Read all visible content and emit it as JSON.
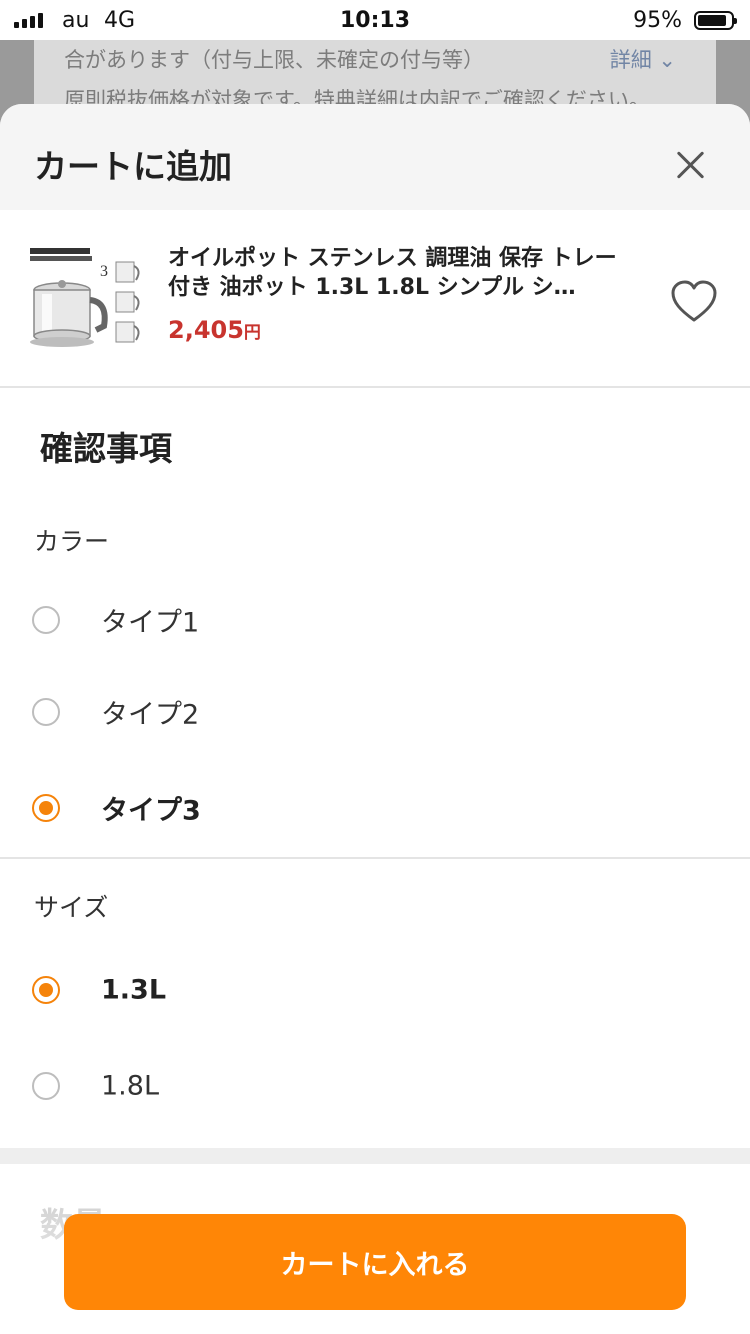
{
  "status": {
    "carrier": "au",
    "network": "4G",
    "time": "10:13",
    "battery": "95%"
  },
  "background_page": {
    "line1": "合があります（付与上限、未確定の付与等）",
    "line2": "原則税抜価格が対象です。特典詳細は内訳でご確認ください。",
    "link": "詳細 ⌄"
  },
  "sheet": {
    "title": "カートに追加",
    "product": {
      "name": "オイルポット ステンレス 調理油 保存 トレー付き 油ポット 1.3L 1.8L シンプル シ…",
      "price": "2,405",
      "price_unit": "円"
    },
    "section_title": "確認事項",
    "color_group": {
      "label": "カラー",
      "options": [
        "タイプ1",
        "タイプ2",
        "タイプ3"
      ],
      "selected": "タイプ3"
    },
    "size_group": {
      "label": "サイズ",
      "options": [
        "1.3L",
        "1.8L"
      ],
      "selected": "1.3L"
    },
    "quantity_label": "数量",
    "add_to_cart": "カートに入れる"
  },
  "colors": {
    "accent": "#ff8606",
    "price": "#c8342e"
  }
}
